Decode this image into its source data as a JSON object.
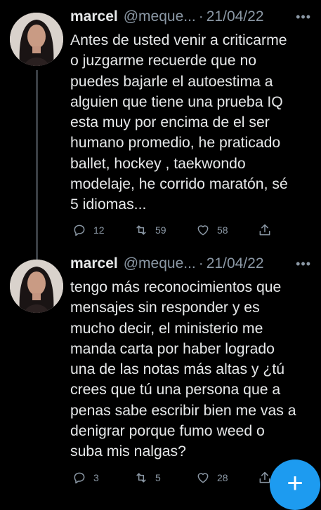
{
  "tweets": [
    {
      "name": "marcel",
      "handle": "@meque...",
      "separator": "·",
      "date": "21/04/22",
      "more": "•••",
      "text": "Antes de usted venir a criticarme\no juzgarme recuerde que no\npuedes bajarle el autoestima a\nalguien que tiene una prueba IQ\nesta muy por encima de el ser\nhumano promedio, he praticado\nballet, hockey , taekwondo\nmodelaje, he corrido maratón, sé\n5 idiomas...",
      "replies": "12",
      "retweets": "59",
      "likes": "58"
    },
    {
      "name": "marcel",
      "handle": "@meque...",
      "separator": "·",
      "date": "21/04/22",
      "more": "•••",
      "text": "tengo más reconocimientos que\nmensajes sin responder y es\nmucho decir, el ministerio me\nmanda carta por haber logrado\nuna de las notas más altas y ¿tú\ncrees que tú una persona que a\npenas sabe escribir bien me vas a\ndenigrar porque fumo weed o\nsuba mis nalgas?",
      "replies": "3",
      "retweets": "5",
      "likes": "28"
    }
  ],
  "fab": {
    "icon": "compose-plus-icon",
    "label": "+",
    "color": "#1d9bf0"
  },
  "colors": {
    "background": "#000000",
    "text": "#e7e9ea",
    "secondary": "#8b98a5"
  }
}
